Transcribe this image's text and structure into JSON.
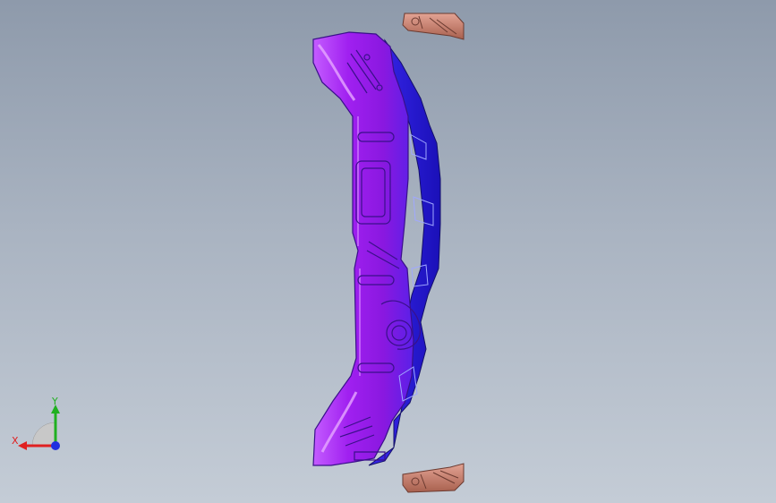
{
  "viewport": {
    "background_top": "#8e9aab",
    "background_bottom": "#c4ccd6"
  },
  "model": {
    "part_color": "#a020f0",
    "part_highlight": "#c45cff",
    "edge_color": "#2a1ad8",
    "fixture_color": "#c98070"
  },
  "triad": {
    "x_label": "X",
    "y_label": "Y",
    "x_color": "#e02020",
    "y_color": "#20b020",
    "z_color": "#2030e0"
  }
}
